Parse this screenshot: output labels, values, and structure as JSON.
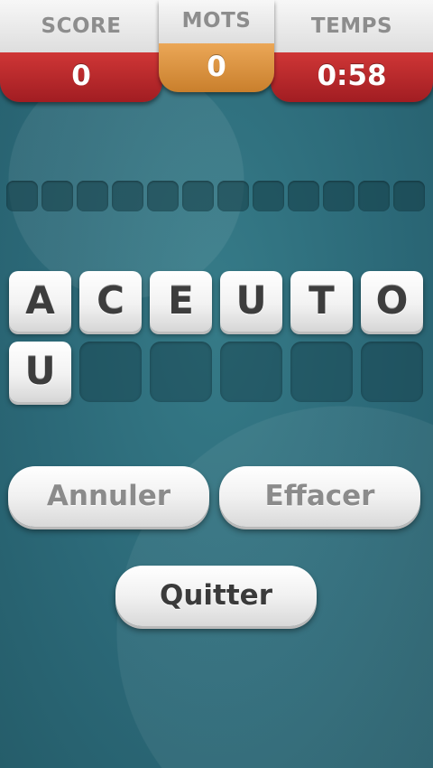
{
  "hud": {
    "score": {
      "label": "SCORE",
      "value": "0"
    },
    "words": {
      "label": "MOTS",
      "value": "0"
    },
    "time": {
      "label": "TEMPS",
      "value": "0:58"
    }
  },
  "answer": {
    "slots": 12
  },
  "letters": [
    "A",
    "C",
    "E",
    "U",
    "T",
    "O",
    "U"
  ],
  "buttons": {
    "cancel": "Annuler",
    "clear": "Effacer",
    "quit": "Quitter"
  },
  "colors": {
    "background": "#2e6f7d",
    "score_red": "#b82a2e",
    "words_orange": "#d99440",
    "tile_text": "#3d3d3d"
  }
}
